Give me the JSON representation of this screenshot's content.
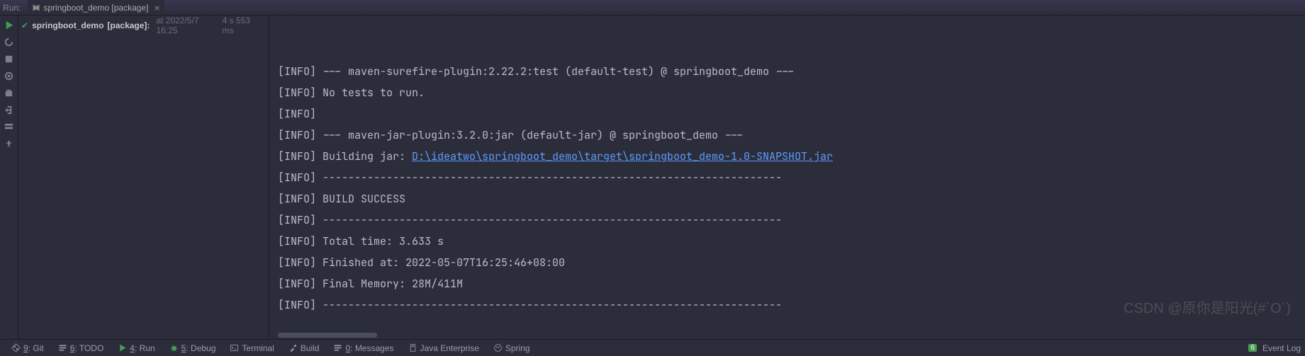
{
  "top": {
    "runLabel": "Run:",
    "tabLabel": "springboot_demo [package]"
  },
  "tree": {
    "name": "springboot_demo",
    "pkg": "[package]:",
    "at": "at 2022/5/7 16:25",
    "duration": "4 s 553 ms"
  },
  "console": {
    "lines": [
      {
        "pre": "[INFO] ",
        "text": "--- maven-surefire-plugin:2.22.2:test (default-test) @ springboot_demo ---"
      },
      {
        "pre": "[INFO] ",
        "text": "No tests to run."
      },
      {
        "pre": "[INFO]",
        "text": ""
      },
      {
        "pre": "[INFO] ",
        "text": "--- maven-jar-plugin:3.2.0:jar (default-jar) @ springboot_demo ---"
      },
      {
        "pre": "[INFO] ",
        "text": "Building jar: ",
        "link": "D:\\ideatwo\\springboot_demo\\target\\springboot_demo-1.0-SNAPSHOT.jar"
      },
      {
        "pre": "[INFO] ",
        "text": "------------------------------------------------------------------------"
      },
      {
        "pre": "[INFO] ",
        "text": "BUILD SUCCESS"
      },
      {
        "pre": "[INFO] ",
        "text": "------------------------------------------------------------------------"
      },
      {
        "pre": "[INFO] ",
        "text": "Total time: 3.633 s"
      },
      {
        "pre": "[INFO] ",
        "text": "Finished at: 2022-05-07T16:25:46+08:00"
      },
      {
        "pre": "[INFO] ",
        "text": "Final Memory: 28M/411M"
      },
      {
        "pre": "[INFO] ",
        "text": "------------------------------------------------------------------------"
      }
    ]
  },
  "status": {
    "git": {
      "key": "9",
      "label": "Git"
    },
    "todo": {
      "key": "6",
      "label": "TODO"
    },
    "run": {
      "key": "4",
      "label": "Run"
    },
    "debug": {
      "key": "5",
      "label": "Debug"
    },
    "terminal": "Terminal",
    "build": "Build",
    "messages": {
      "key": "0",
      "label": "Messages"
    },
    "javaEnt": "Java Enterprise",
    "spring": "Spring",
    "badge": "6",
    "eventLog": "Event Log"
  },
  "watermark": "CSDN @原你是阳光(#`O´)"
}
